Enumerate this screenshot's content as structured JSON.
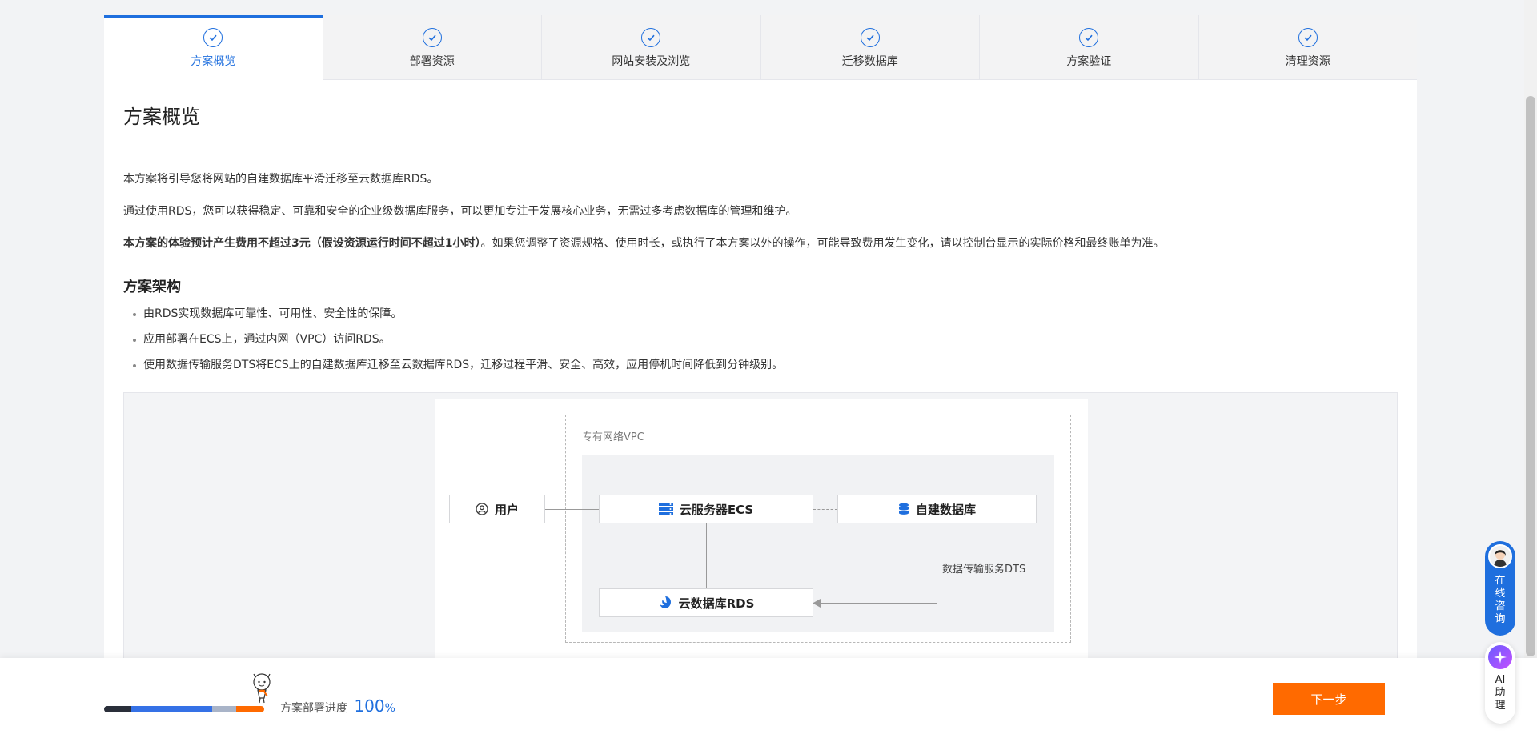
{
  "steps": [
    {
      "label": "方案概览",
      "active": true
    },
    {
      "label": "部署资源",
      "active": false
    },
    {
      "label": "网站安装及浏览",
      "active": false
    },
    {
      "label": "迁移数据库",
      "active": false
    },
    {
      "label": "方案验证",
      "active": false
    },
    {
      "label": "清理资源",
      "active": false
    }
  ],
  "page": {
    "title": "方案概览",
    "intro1": "本方案将引导您将网站的自建数据库平滑迁移至云数据库RDS。",
    "intro2": "通过使用RDS，您可以获得稳定、可靠和安全的企业级数据库服务，可以更加专注于发展核心业务，无需过多考虑数据库的管理和维护。",
    "cost_bold": "本方案的体验预计产生费用不超过3元（假设资源运行时间不超过1小时）",
    "cost_rest": "。如果您调整了资源规格、使用时长，或执行了本方案以外的操作，可能导致费用发生变化，请以控制台显示的实际价格和最终账单为准。",
    "arch_title": "方案架构",
    "arch_bullets": [
      "由RDS实现数据库可靠性、可用性、安全性的保障。",
      "应用部署在ECS上，通过内网（VPC）访问RDS。",
      "使用数据传输服务DTS将ECS上的自建数据库迁移至云数据库RDS，迁移过程平滑、安全、高效，应用停机时间降低到分钟级别。"
    ]
  },
  "diagram": {
    "vpc_label": "专有网络VPC",
    "user": "用户",
    "ecs": "云服务器ECS",
    "db": "自建数据库",
    "rds": "云数据库RDS",
    "dts": "数据传输服务DTS"
  },
  "bottom": {
    "progress_label": "方案部署进度",
    "progress_value": "100",
    "progress_unit": "%",
    "progress_fraction": 1.0,
    "next_button": "下一步"
  },
  "float": {
    "consult": "在线咨询",
    "ai": "AI助理"
  },
  "colors": {
    "accent": "#1f6fde",
    "primary_button": "#ff6a00"
  }
}
